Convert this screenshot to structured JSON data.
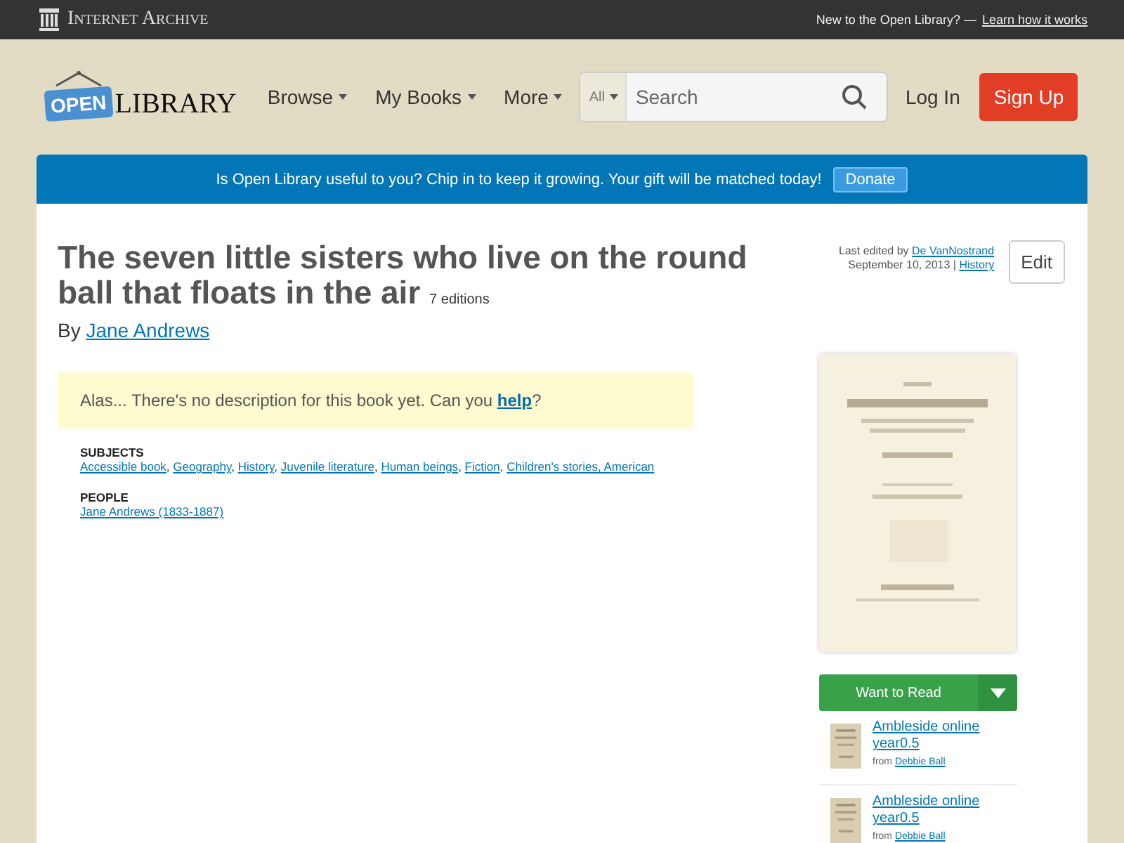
{
  "topbar": {
    "brand": "Internet Archive",
    "prompt": "New to the Open Library? —",
    "link": "Learn how it works"
  },
  "header": {
    "logo_badge": "OPEN",
    "logo_text": "LIBRARY",
    "nav": [
      "Browse",
      "My Books",
      "More"
    ],
    "search": {
      "scope": "All",
      "placeholder": "Search"
    },
    "login": "Log In",
    "signup": "Sign Up"
  },
  "banner": {
    "message": "Is Open Library useful to you? Chip in to keep it growing. Your gift will be matched today!",
    "button": "Donate"
  },
  "work": {
    "title": "The seven little sisters who live on the round ball that floats in the air",
    "editions": "7 editions",
    "by": "By",
    "author": "Jane Andrews"
  },
  "edit_info": {
    "prefix": "Last edited by",
    "editor": "De VanNostrand",
    "date": "September 10, 2013",
    "separator": "|",
    "history": "History",
    "button": "Edit"
  },
  "description": {
    "before": "Alas... There's no description for this book yet. Can you",
    "link": "help",
    "after": "?"
  },
  "subjects": {
    "heading": "SUBJECTS",
    "separator": ", ",
    "items": [
      "Accessible book",
      "Geography",
      "History",
      "Juvenile literature",
      "Human beings",
      "Fiction",
      "Children's stories, American"
    ]
  },
  "people": {
    "heading": "PEOPLE",
    "items": [
      "Jane Andrews (1833-1887)"
    ]
  },
  "want_to_read": {
    "label": "Want to Read"
  },
  "lists": [
    {
      "title": "Ambleside online year0.5",
      "from": "from",
      "owner": "Debbie Ball"
    },
    {
      "title": "Ambleside online year0.5",
      "from": "from",
      "owner": "Debbie Ball"
    }
  ]
}
